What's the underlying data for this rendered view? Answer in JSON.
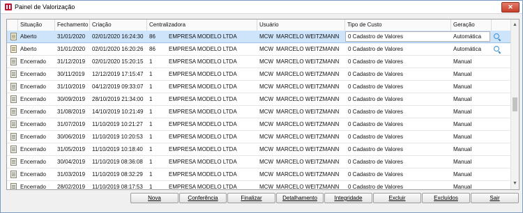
{
  "window": {
    "title": "Painel de Valorização",
    "close_label": "✕"
  },
  "columns": [
    "Situação",
    "Fechamento",
    "Criação",
    "Centralizadora",
    "Usuário",
    "Tipo de Custo",
    "Geração"
  ],
  "rows": [
    {
      "situacao": "Aberto",
      "fechamento": "31/01/2020",
      "criacao": "02/01/2020 16:24:30",
      "cod": "86",
      "empresa": "EMPRESA MODELO LTDA",
      "usuario_cod": "MCW",
      "usuario_nome": "MARCELO WEITZMANN",
      "tipo": "0 Cadastro de Valores",
      "geracao": "Automática",
      "icon": "document-open-icon",
      "search": true,
      "selected": true
    },
    {
      "situacao": "Aberto",
      "fechamento": "31/01/2020",
      "criacao": "02/01/2020 16:20:26",
      "cod": "86",
      "empresa": "EMPRESA MODELO LTDA",
      "usuario_cod": "MCW",
      "usuario_nome": "MARCELO WEITZMANN",
      "tipo": "0 Cadastro de Valores",
      "geracao": "Automática",
      "icon": "document-open-icon",
      "search": true,
      "selected": false
    },
    {
      "situacao": "Encerrado",
      "fechamento": "31/12/2019",
      "criacao": "02/01/2020 15:20:15",
      "cod": "1",
      "empresa": "EMPRESA MODELO LTDA",
      "usuario_cod": "MCW",
      "usuario_nome": "MARCELO WEITZMANN",
      "tipo": "0 Cadastro de Valores",
      "geracao": "Manual",
      "icon": "document-closed-icon",
      "search": false,
      "selected": false
    },
    {
      "situacao": "Encerrado",
      "fechamento": "30/11/2019",
      "criacao": "12/12/2019 17:15:47",
      "cod": "1",
      "empresa": "EMPRESA MODELO LTDA",
      "usuario_cod": "MCW",
      "usuario_nome": "MARCELO WEITZMANN",
      "tipo": "0 Cadastro de Valores",
      "geracao": "Manual",
      "icon": "document-closed-icon",
      "search": false,
      "selected": false
    },
    {
      "situacao": "Encerrado",
      "fechamento": "31/10/2019",
      "criacao": "04/12/2019 09:33:07",
      "cod": "1",
      "empresa": "EMPRESA MODELO LTDA",
      "usuario_cod": "MCW",
      "usuario_nome": "MARCELO WEITZMANN",
      "tipo": "0 Cadastro de Valores",
      "geracao": "Manual",
      "icon": "document-closed-icon",
      "search": false,
      "selected": false
    },
    {
      "situacao": "Encerrado",
      "fechamento": "30/09/2019",
      "criacao": "28/10/2019 21:34:00",
      "cod": "1",
      "empresa": "EMPRESA MODELO LTDA",
      "usuario_cod": "MCW",
      "usuario_nome": "MARCELO WEITZMANN",
      "tipo": "0 Cadastro de Valores",
      "geracao": "Manual",
      "icon": "document-closed-icon",
      "search": false,
      "selected": false
    },
    {
      "situacao": "Encerrado",
      "fechamento": "31/08/2019",
      "criacao": "14/10/2019 10:21:49",
      "cod": "1",
      "empresa": "EMPRESA MODELO LTDA",
      "usuario_cod": "MCW",
      "usuario_nome": "MARCELO WEITZMANN",
      "tipo": "0 Cadastro de Valores",
      "geracao": "Manual",
      "icon": "document-closed-icon",
      "search": false,
      "selected": false
    },
    {
      "situacao": "Encerrado",
      "fechamento": "31/07/2019",
      "criacao": "11/10/2019 10:21:27",
      "cod": "1",
      "empresa": "EMPRESA MODELO LTDA",
      "usuario_cod": "MCW",
      "usuario_nome": "MARCELO WEITZMANN",
      "tipo": "0 Cadastro de Valores",
      "geracao": "Manual",
      "icon": "document-closed-icon",
      "search": false,
      "selected": false
    },
    {
      "situacao": "Encerrado",
      "fechamento": "30/06/2019",
      "criacao": "11/10/2019 10:20:53",
      "cod": "1",
      "empresa": "EMPRESA MODELO LTDA",
      "usuario_cod": "MCW",
      "usuario_nome": "MARCELO WEITZMANN",
      "tipo": "0 Cadastro de Valores",
      "geracao": "Manual",
      "icon": "document-closed-icon",
      "search": false,
      "selected": false
    },
    {
      "situacao": "Encerrado",
      "fechamento": "31/05/2019",
      "criacao": "11/10/2019 10:18:40",
      "cod": "1",
      "empresa": "EMPRESA MODELO LTDA",
      "usuario_cod": "MCW",
      "usuario_nome": "MARCELO WEITZMANN",
      "tipo": "0 Cadastro de Valores",
      "geracao": "Manual",
      "icon": "document-closed-icon",
      "search": false,
      "selected": false
    },
    {
      "situacao": "Encerrado",
      "fechamento": "30/04/2019",
      "criacao": "11/10/2019 08:36:08",
      "cod": "1",
      "empresa": "EMPRESA MODELO LTDA",
      "usuario_cod": "MCW",
      "usuario_nome": "MARCELO WEITZMANN",
      "tipo": "0 Cadastro de Valores",
      "geracao": "Manual",
      "icon": "document-closed-icon",
      "search": false,
      "selected": false
    },
    {
      "situacao": "Encerrado",
      "fechamento": "31/03/2019",
      "criacao": "11/10/2019 08:32:29",
      "cod": "1",
      "empresa": "EMPRESA MODELO LTDA",
      "usuario_cod": "MCW",
      "usuario_nome": "MARCELO WEITZMANN",
      "tipo": "0 Cadastro de Valores",
      "geracao": "Manual",
      "icon": "document-closed-icon",
      "search": false,
      "selected": false
    },
    {
      "situacao": "Encerrado",
      "fechamento": "28/02/2019",
      "criacao": "11/10/2019 08:17:53",
      "cod": "1",
      "empresa": "EMPRESA MODELO LTDA",
      "usuario_cod": "MCW",
      "usuario_nome": "MARCELO WEITZMANN",
      "tipo": "0 Cadastro de Valores",
      "geracao": "Manual",
      "icon": "document-closed-icon",
      "search": false,
      "selected": false
    }
  ],
  "scrollbar": {
    "up": "▲",
    "down": "▼"
  },
  "buttons": [
    {
      "id": "nova",
      "label": "Nova"
    },
    {
      "id": "conferencia",
      "label": "Conferência"
    },
    {
      "id": "finalizar",
      "label": "Finalizar"
    },
    {
      "id": "detalhamento",
      "label": "Detalhamento"
    },
    {
      "id": "integridade",
      "label": "Integridade"
    },
    {
      "id": "excluir",
      "label": "Excluir"
    },
    {
      "id": "excluidos",
      "label": "Excluídos"
    },
    {
      "id": "sair",
      "label": "Sair"
    }
  ]
}
